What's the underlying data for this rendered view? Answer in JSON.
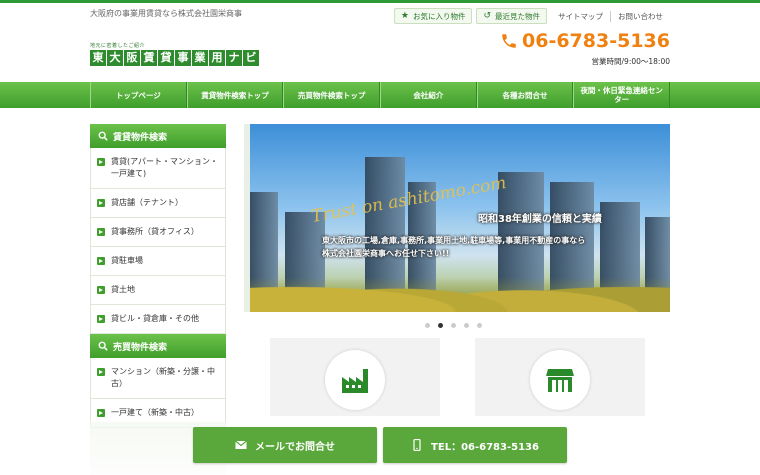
{
  "header": {
    "tagline": "大阪府の事業用賃貸なら株式会社園栄商事",
    "logo_small": "地元に密着したご紹介",
    "logo_chars": [
      "東",
      "大",
      "阪",
      "賃",
      "貸",
      "事",
      "業",
      "用",
      "ナ",
      "ビ"
    ],
    "favorites_label": "お気に入り物件",
    "recent_label": "最近見た物件",
    "sitemap_label": "サイトマップ",
    "contact_label": "お問い合わせ",
    "phone": "06-6783-5136",
    "hours": "営業時間/9:00～18:00"
  },
  "nav": {
    "items": [
      {
        "label": "トップページ"
      },
      {
        "label": "賃貸物件検索トップ"
      },
      {
        "label": "売買物件検索トップ"
      },
      {
        "label": "会社紹介"
      },
      {
        "label": "各種お問合せ"
      },
      {
        "label": "夜間・休日緊急連絡センター"
      }
    ]
  },
  "sidebar": {
    "rent_title": "賃貸物件検索",
    "rent_items": [
      {
        "label": "賃貸(アパート・マンション・一戸建て)"
      },
      {
        "label": "貸店舗（テナント）"
      },
      {
        "label": "貸事務所（貸オフィス）"
      },
      {
        "label": "貸駐車場"
      },
      {
        "label": "貸土地"
      },
      {
        "label": "貸ビル・貸倉庫・その他"
      }
    ],
    "sale_title": "売買物件検索",
    "sale_items": [
      {
        "label": "マンション（新築・分譲・中古）"
      },
      {
        "label": "一戸建て（新築・中古）"
      }
    ]
  },
  "hero": {
    "script_text": "Trust on ashitomo.com",
    "catch": "昭和38年創業の信頼と実績",
    "desc_line1": "東大阪市の工場,倉庫,事務所,事業用土地,駐車場等,事業用不動産の事なら",
    "desc_line2": "株式会社園栄商事へお任せ下さい!!",
    "slides": 5,
    "active_slide": 2
  },
  "cards": [
    {
      "icon": "factory-icon"
    },
    {
      "icon": "store-icon"
    }
  ],
  "cta": {
    "mail_label": "メールでお問合せ",
    "tel_label": "TEL：06-6783-5136"
  },
  "colors": {
    "accent_green": "#3f9e2c",
    "phone_orange": "#f08010"
  }
}
